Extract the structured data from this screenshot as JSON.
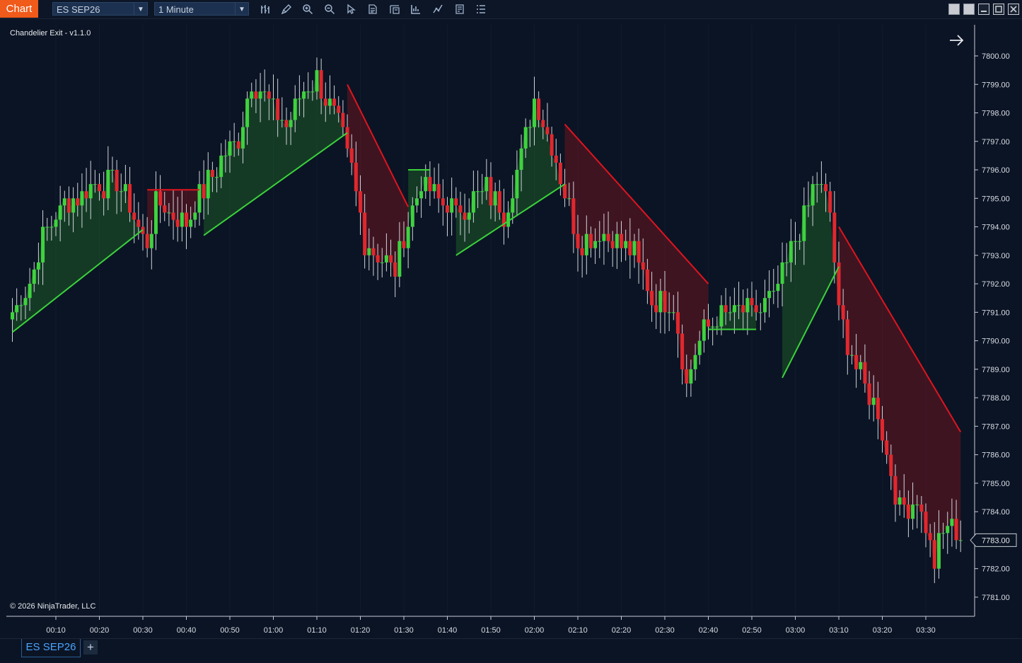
{
  "toolbar": {
    "chart_tab": "Chart",
    "instrument": "ES SEP26",
    "interval": "1 Minute",
    "tools": [
      "bar-type-icon",
      "pencil-icon",
      "zoom-in-icon",
      "zoom-out-icon",
      "pointer-icon",
      "data-box-icon",
      "chart-trader-icon",
      "strategies-icon",
      "indicators-icon",
      "properties-icon",
      "menu-list-icon"
    ]
  },
  "chart": {
    "indicator_label": "Chandelier Exit - v1.1.0",
    "copyright": "© 2026 NinjaTrader, LLC",
    "current_price_label": "7783.00"
  },
  "bottom": {
    "instrument_tab": "ES SEP26",
    "add_tab": "+"
  },
  "colors": {
    "background": "#0b1424",
    "bull": "#3fd23f",
    "bear": "#e0282e",
    "bull_line": "#3bd23b",
    "bear_line": "#e0141e",
    "bull_fill": "rgba(40,140,40,0.32)",
    "bear_fill": "rgba(150,20,30,0.38)",
    "axis_text": "#d8dde6"
  },
  "chart_data": {
    "type": "candlestick",
    "title": "Chandelier Exit - v1.1.0",
    "instrument": "ES SEP26",
    "interval": "1 Minute",
    "ylim": [
      7780.5,
      7801.1
    ],
    "y_ticks": [
      "7800.00",
      "7799.00",
      "7798.00",
      "7797.00",
      "7796.00",
      "7795.00",
      "7794.00",
      "7793.00",
      "7792.00",
      "7791.00",
      "7790.00",
      "7789.00",
      "7788.00",
      "7787.00",
      "7786.00",
      "7785.00",
      "7784.00",
      "7783.00",
      "7782.00",
      "7781.00"
    ],
    "x_ticks": [
      "00:10",
      "00:20",
      "00:30",
      "00:40",
      "00:50",
      "01:00",
      "01:10",
      "01:20",
      "01:30",
      "01:40",
      "01:50",
      "02:00",
      "02:10",
      "02:20",
      "02:30",
      "02:40",
      "02:50",
      "03:00",
      "03:10",
      "03:20",
      "03:30"
    ],
    "price_series_anchors": [
      {
        "time": "00:00",
        "price": 7791.0
      },
      {
        "time": "00:04",
        "price": 7792.0
      },
      {
        "time": "00:07",
        "price": 7793.7
      },
      {
        "time": "00:12",
        "price": 7794.8
      },
      {
        "time": "00:18",
        "price": 7795.4
      },
      {
        "time": "00:24",
        "price": 7795.6
      },
      {
        "time": "00:31",
        "price": 7793.4
      },
      {
        "time": "00:33",
        "price": 7794.8
      },
      {
        "time": "00:40",
        "price": 7794.2
      },
      {
        "time": "00:45",
        "price": 7795.6
      },
      {
        "time": "00:52",
        "price": 7797.2
      },
      {
        "time": "00:55",
        "price": 7799.2
      },
      {
        "time": "00:58",
        "price": 7798.5
      },
      {
        "time": "01:03",
        "price": 7797.6
      },
      {
        "time": "01:07",
        "price": 7798.8
      },
      {
        "time": "01:10",
        "price": 7799.2
      },
      {
        "time": "01:15",
        "price": 7797.5
      },
      {
        "time": "01:18",
        "price": 7796.0
      },
      {
        "time": "01:21",
        "price": 7793.5
      },
      {
        "time": "01:28",
        "price": 7792.5
      },
      {
        "time": "01:31",
        "price": 7794.2
      },
      {
        "time": "01:34",
        "price": 7795.5
      },
      {
        "time": "01:38",
        "price": 7795.0
      },
      {
        "time": "01:42",
        "price": 7794.5
      },
      {
        "time": "01:49",
        "price": 7795.3
      },
      {
        "time": "01:53",
        "price": 7794.5
      },
      {
        "time": "01:57",
        "price": 7796.5
      },
      {
        "time": "02:00",
        "price": 7798.5
      },
      {
        "time": "02:04",
        "price": 7797.0
      },
      {
        "time": "02:07",
        "price": 7795.2
      },
      {
        "time": "02:10",
        "price": 7793.5
      },
      {
        "time": "02:16",
        "price": 7793.8
      },
      {
        "time": "02:23",
        "price": 7793.0
      },
      {
        "time": "02:27",
        "price": 7791.5
      },
      {
        "time": "02:32",
        "price": 7791.3
      },
      {
        "time": "02:35",
        "price": 7788.5
      },
      {
        "time": "02:39",
        "price": 7790.5
      },
      {
        "time": "02:45",
        "price": 7791.0
      },
      {
        "time": "02:51",
        "price": 7791.0
      },
      {
        "time": "02:55",
        "price": 7791.5
      },
      {
        "time": "03:00",
        "price": 7793.5
      },
      {
        "time": "03:05",
        "price": 7795.7
      },
      {
        "time": "03:08",
        "price": 7794.5
      },
      {
        "time": "03:10",
        "price": 7791.0
      },
      {
        "time": "03:14",
        "price": 7789.0
      },
      {
        "time": "03:19",
        "price": 7787.5
      },
      {
        "time": "03:24",
        "price": 7784.0
      },
      {
        "time": "03:28",
        "price": 7784.5
      },
      {
        "time": "03:32",
        "price": 7782.3
      },
      {
        "time": "03:35",
        "price": 7783.7
      },
      {
        "time": "03:38",
        "price": 7783.0
      }
    ],
    "chandelier_exit": [
      {
        "side": "long",
        "from": "00:00",
        "to": "00:30",
        "level_start": 7790.3,
        "level_end": 7793.9
      },
      {
        "side": "short",
        "from": "00:31",
        "to": "00:43",
        "level": 7795.3
      },
      {
        "side": "long",
        "from": "00:44",
        "to": "01:17",
        "level_start": 7793.7,
        "level_end": 7797.3
      },
      {
        "side": "short",
        "from": "01:17",
        "to": "01:31",
        "level_start": 7799.0,
        "level_end": 7794.7
      },
      {
        "side": "long",
        "from": "01:31",
        "to": "01:36",
        "level": 7796.0
      },
      {
        "side": "long",
        "from": "01:42",
        "to": "02:07",
        "level_start": 7793.0,
        "level_end": 7795.5
      },
      {
        "side": "short",
        "from": "02:07",
        "to": "02:40",
        "level_start": 7797.6,
        "level_end": 7792.0
      },
      {
        "side": "long",
        "from": "02:40",
        "to": "02:51",
        "level": 7790.4
      },
      {
        "side": "long",
        "from": "02:57",
        "to": "03:10",
        "level_start": 7788.7,
        "level_end": 7792.6
      },
      {
        "side": "short",
        "from": "03:10",
        "to": "03:38",
        "level_start": 7794.0,
        "level_end": 7786.8
      }
    ],
    "last_price": 7783.0
  }
}
